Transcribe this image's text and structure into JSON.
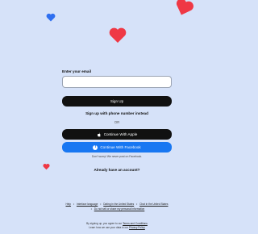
{
  "colors": {
    "background": "#d6e2f9",
    "heart_red": "#ef3845",
    "heart_blue": "#2f6ff0",
    "dark_button": "#111111",
    "facebook_blue": "#1877f2"
  },
  "form": {
    "email_label": "Enter your email",
    "email_value": "",
    "sign_up_label": "Sign Up",
    "phone_link": "Sign up with phone number instead",
    "or_text": "OR",
    "apple_label": "Continue With Apple",
    "apple_icon": "apple-icon",
    "facebook_label": "Continue With Facebook",
    "facebook_icon": "facebook-icon",
    "facebook_note": "Don't worry! We never post on Facebook.",
    "have_account": "Already have an account?"
  },
  "footer": {
    "links": [
      "Help",
      "Interface language",
      "Dating in the United States",
      "Chat in the United States"
    ],
    "privacy_link": "Do not sell or share my personal information"
  },
  "legal": {
    "line1_prefix": "By signing up, you agree to our",
    "terms_link": "Terms and Conditions",
    "line2_prefix": "Learn how we use your data in our",
    "privacy_policy_link": "Privacy Policy"
  }
}
